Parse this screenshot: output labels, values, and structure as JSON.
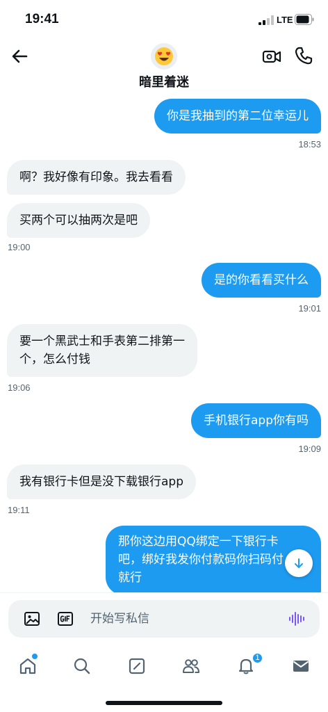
{
  "status_bar": {
    "time": "19:41",
    "network": "LTE"
  },
  "header": {
    "contact_name": "暗里着迷",
    "avatar_emoji": "😍"
  },
  "messages": [
    {
      "dir": "out",
      "text": "你是我抽到的第二位幸运儿"
    },
    {
      "dir": "ts-right",
      "text": "18:53"
    },
    {
      "dir": "in",
      "text": "啊？我好像有印象。我去看看"
    },
    {
      "dir": "in",
      "text": "买两个可以抽两次是吧"
    },
    {
      "dir": "ts-left",
      "text": "19:00"
    },
    {
      "dir": "out",
      "text": "是的你看看买什么"
    },
    {
      "dir": "ts-right",
      "text": "19:01"
    },
    {
      "dir": "in",
      "line1": "要一个黑武士和手表第二排第一",
      "line2": "个，怎么付钱"
    },
    {
      "dir": "ts-left",
      "text": "19:06"
    },
    {
      "dir": "out",
      "text": "手机银行app你有吗"
    },
    {
      "dir": "ts-right",
      "text": "19:09"
    },
    {
      "dir": "in",
      "text": "我有银行卡但是没下载银行app"
    },
    {
      "dir": "ts-left",
      "text": "19:11"
    },
    {
      "dir": "out",
      "line1": "那你这边用QQ绑定一下银行卡",
      "line2": "吧，绑好我发你付款码你扫码付",
      "line3": "就行"
    }
  ],
  "composer": {
    "placeholder": "开始写私信"
  },
  "nav": {
    "notification_count": "1"
  },
  "colors": {
    "accent": "#1d9bf0",
    "incoming_bubble": "#eff3f4",
    "voice_icon": "#7856ff"
  }
}
